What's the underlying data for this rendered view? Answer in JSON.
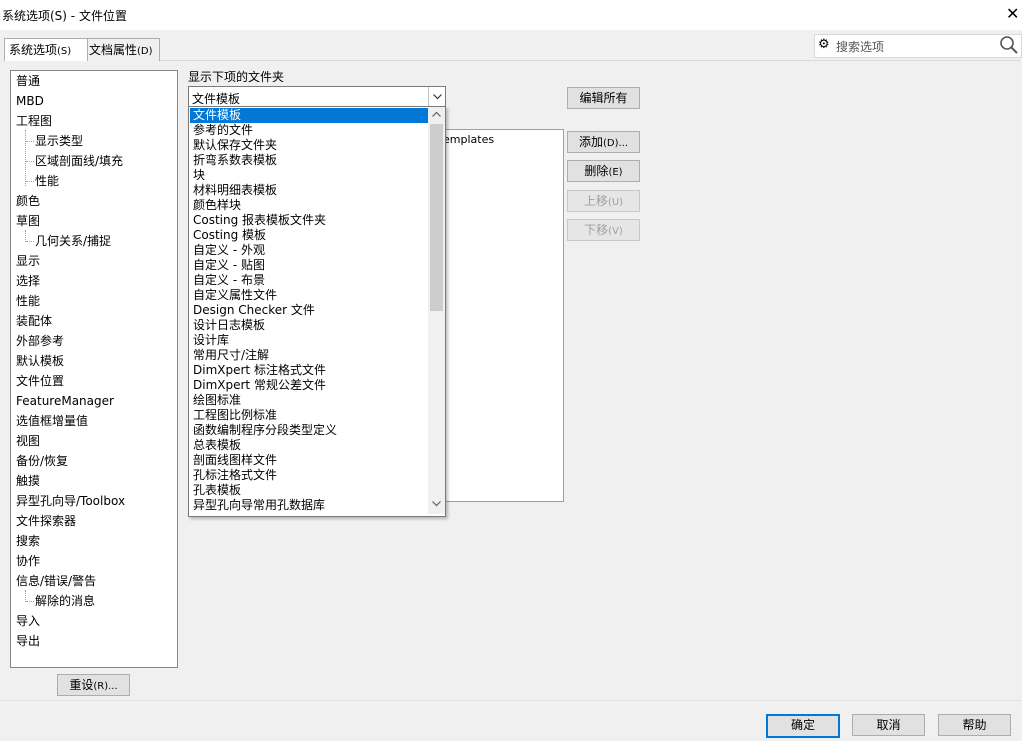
{
  "window": {
    "title": "系统选项(S) - 文件位置",
    "close_icon": "close-icon"
  },
  "tabs": [
    {
      "label": "系统选项",
      "hotkey": "(S)",
      "active": true
    },
    {
      "label": "文档属性",
      "hotkey": "(D)",
      "active": false
    }
  ],
  "search": {
    "placeholder": "搜索选项",
    "icon_left": "gear-icon",
    "icon_right": "search-icon"
  },
  "tree": {
    "items": [
      "普通",
      "MBD",
      "工程图",
      "显示类型",
      "区域剖面线/填充",
      "性能",
      "颜色",
      "草图",
      "几何关系/捕捉",
      "显示",
      "选择",
      "性能",
      "装配体",
      "外部参考",
      "默认模板",
      "文件位置",
      "FeatureManager",
      "选值框增量值",
      "视图",
      "备份/恢复",
      "触摸",
      "异型孔向导/Toolbox",
      "文件探索器",
      "搜索",
      "协作",
      "信息/错误/警告",
      "解除的消息",
      "导入",
      "导出"
    ],
    "selected": "文件位置"
  },
  "reset_button": {
    "label": "重设",
    "hotkey": "(R)..."
  },
  "folder": {
    "label": "显示下项的文件夹",
    "combo_value": "文件模板",
    "list_entry_partial": "emplates",
    "options": [
      "文件模板",
      "参考的文件",
      "默认保存文件夹",
      "折弯系数表模板",
      "块",
      "材料明细表模板",
      "颜色样块",
      "Costing 报表模板文件夹",
      "Costing 模板",
      "自定义 - 外观",
      "自定义 - 贴图",
      "自定义 - 布景",
      "自定义属性文件",
      "Design Checker 文件",
      "设计日志模板",
      "设计库",
      "常用尺寸/注解",
      "DimXpert 标注格式文件",
      "DimXpert 常规公差文件",
      "绘图标准",
      "工程图比例标准",
      "函数编制程序分段类型定义",
      "总表模板",
      "剖面线图样文件",
      "孔标注格式文件",
      "孔表模板",
      "异型孔向导常用孔数据库"
    ]
  },
  "buttons": {
    "edit_all": {
      "label": "编辑所有"
    },
    "add": {
      "label": "添加",
      "hotkey": "(D)..."
    },
    "delete": {
      "label": "删除",
      "hotkey": "(E)"
    },
    "move_up": {
      "label": "上移",
      "hotkey": "(U)"
    },
    "move_down": {
      "label": "下移",
      "hotkey": "(V)"
    }
  },
  "footer": {
    "ok": "确定",
    "cancel": "取消",
    "help": "帮助"
  },
  "colors": {
    "selection": "#0078d7",
    "dialog_bg": "#f0f0f0"
  }
}
